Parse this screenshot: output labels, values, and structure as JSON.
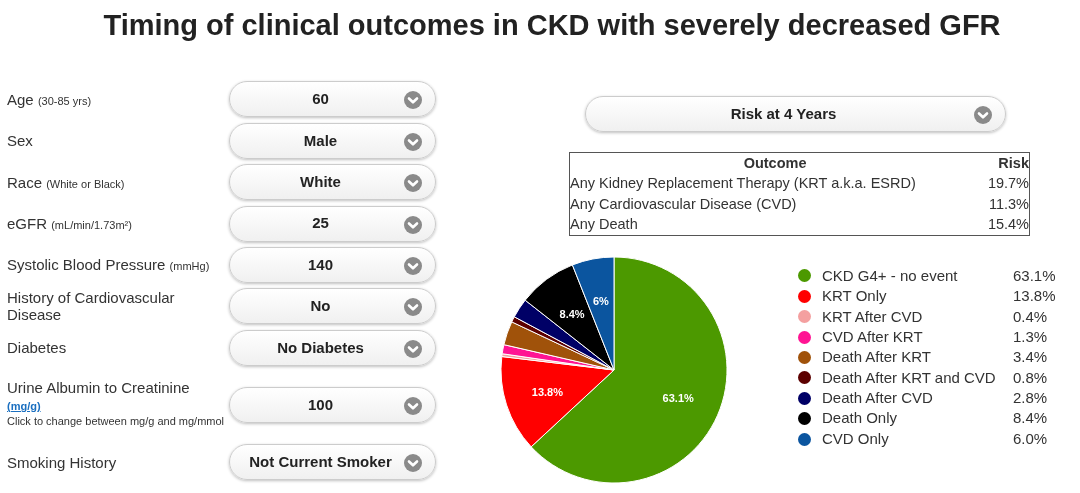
{
  "title": "Timing of clinical outcomes in CKD with severely decreased GFR",
  "inputs": [
    {
      "label": "Age",
      "hint": "(30-85 yrs)",
      "value": "60"
    },
    {
      "label": "Sex",
      "value": "Male"
    },
    {
      "label": "Race",
      "hint": "(White or Black)",
      "value": "White"
    },
    {
      "label": "eGFR",
      "hint": "(mL/min/1.73m²)",
      "value": "25"
    },
    {
      "label": "Systolic Blood Pressure",
      "hint": "(mmHg)",
      "value": "140"
    },
    {
      "label": "History of Cardiovascular Disease",
      "value": "No"
    },
    {
      "label": "Diabetes",
      "value": "No Diabetes"
    },
    {
      "label": "Urine Albumin to Creatinine",
      "unit_link": "(mg/g)",
      "note": "Click to change between mg/g and mg/mmol",
      "value": "100"
    },
    {
      "label": "Smoking History",
      "value": "Not Current Smoker"
    }
  ],
  "horizon": {
    "value": "Risk at 4 Years"
  },
  "risk_table": {
    "columns": [
      "Outcome",
      "Risk"
    ],
    "rows": [
      [
        "Any Kidney Replacement Therapy (KRT a.k.a. ESRD)",
        "19.7%"
      ],
      [
        "Any Cardiovascular Disease (CVD)",
        "11.3%"
      ],
      [
        "Any Death",
        "15.4%"
      ]
    ]
  },
  "chart_data": {
    "type": "pie",
    "categories": [
      "CKD G4+ - no event",
      "KRT Only",
      "KRT After CVD",
      "CVD After KRT",
      "Death After KRT",
      "Death After KRT and CVD",
      "Death After CVD",
      "Death Only",
      "CVD Only"
    ],
    "values": [
      63.1,
      13.8,
      0.4,
      1.3,
      3.4,
      0.8,
      2.8,
      8.4,
      6.0
    ],
    "colors": [
      "#4c9900",
      "#ff0000",
      "#f4a0a0",
      "#ff1493",
      "#a0520a",
      "#5c0000",
      "#000066",
      "#000000",
      "#0b559f"
    ],
    "value_labels": [
      "63.1%",
      "13.8%",
      null,
      null,
      null,
      null,
      null,
      "8.4%",
      "6%"
    ]
  },
  "legend": {
    "values": [
      "63.1%",
      "13.8%",
      "0.4%",
      "1.3%",
      "3.4%",
      "0.8%",
      "2.8%",
      "8.4%",
      "6.0%"
    ]
  }
}
